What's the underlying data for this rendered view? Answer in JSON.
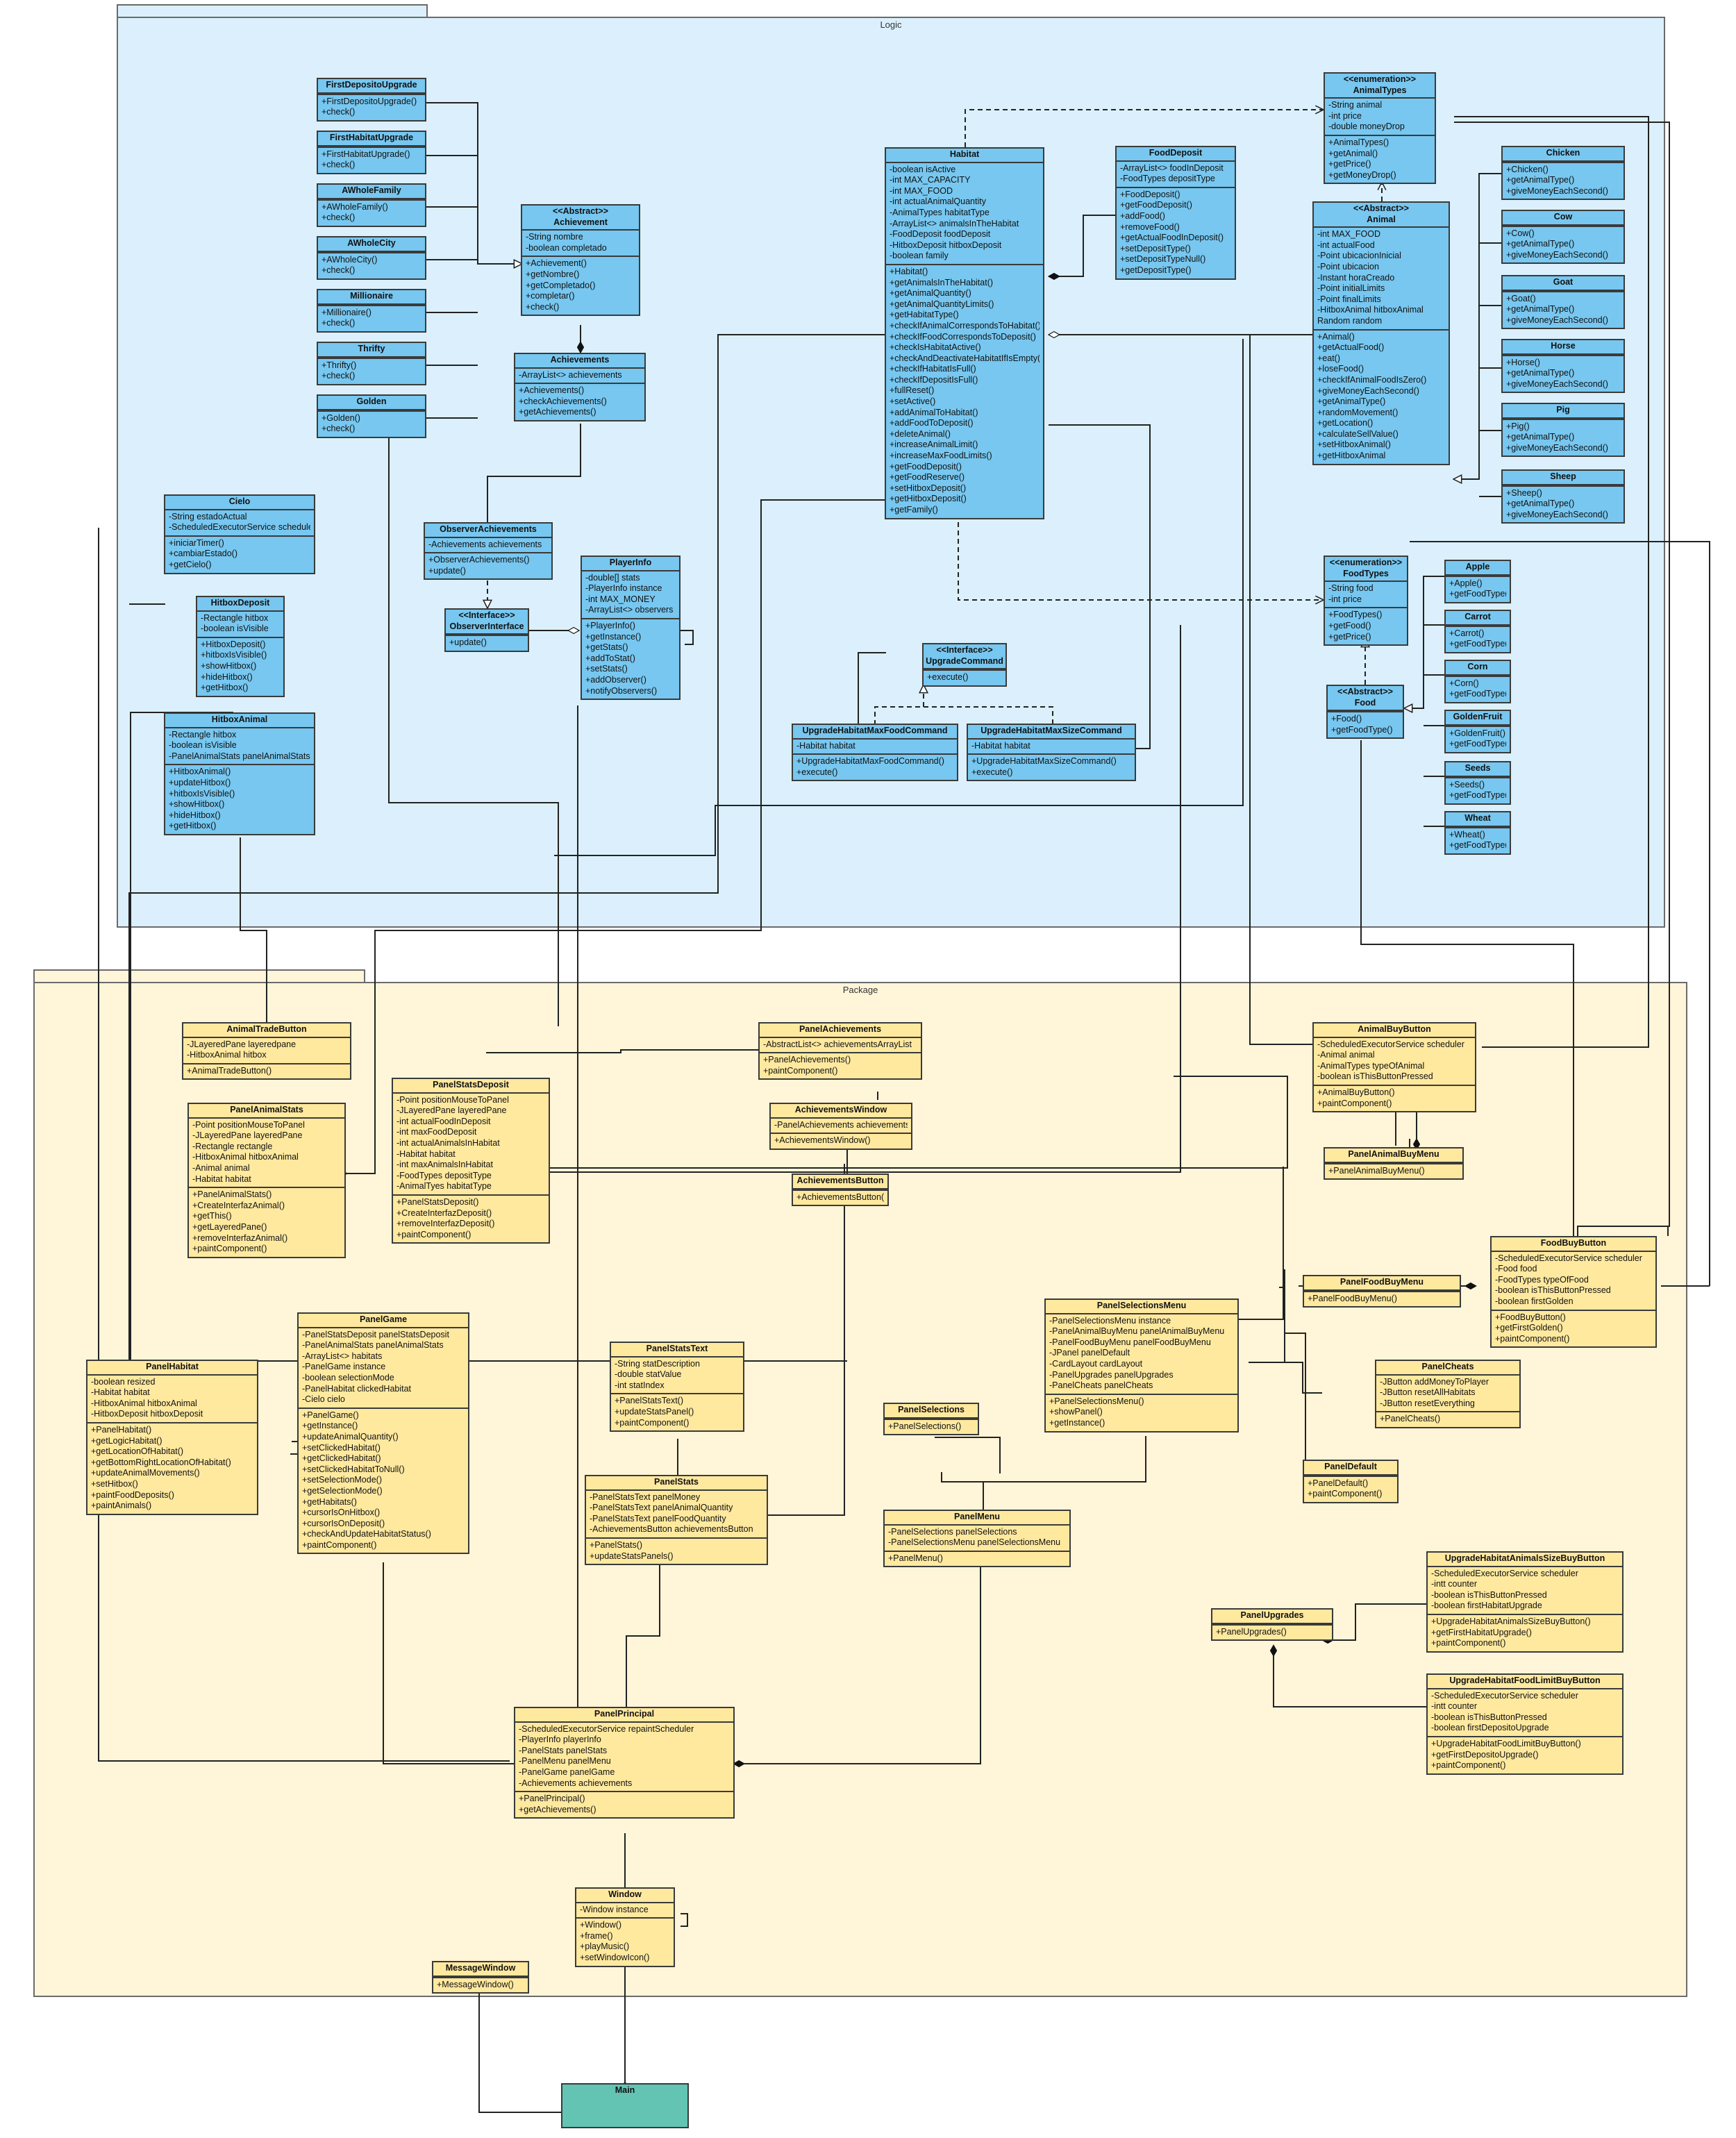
{
  "packages": {
    "logic": "Logic",
    "package": "Package"
  },
  "classes": [
    {
      "id": "first-deposito-upgrade",
      "name": [
        "FirstDepositoUpgrade"
      ],
      "attrs": [],
      "methods": [
        "+FirstDepositoUpgrade()",
        "+check()"
      ]
    },
    {
      "id": "first-habitat-upgrade",
      "name": [
        "FirstHabitatUpgrade"
      ],
      "attrs": [],
      "methods": [
        "+FirstHabitatUpgrade()",
        "+check()"
      ]
    },
    {
      "id": "a-whole-family",
      "name": [
        "AWholeFamily"
      ],
      "attrs": [],
      "methods": [
        "+AWholeFamily()",
        "+check()"
      ]
    },
    {
      "id": "a-whole-city",
      "name": [
        "AWholeCity"
      ],
      "attrs": [],
      "methods": [
        "+AWholeCity()",
        "+check()"
      ]
    },
    {
      "id": "millionaire",
      "name": [
        "Millionaire"
      ],
      "attrs": [],
      "methods": [
        "+Millionaire()",
        "+check()"
      ]
    },
    {
      "id": "thrifty",
      "name": [
        "Thrifty"
      ],
      "attrs": [],
      "methods": [
        "+Thrifty()",
        "+check()"
      ]
    },
    {
      "id": "golden",
      "name": [
        "Golden"
      ],
      "attrs": [],
      "methods": [
        "+Golden()",
        "+check()"
      ]
    },
    {
      "id": "achievement",
      "name": [
        "<<Abstract>>",
        "Achievement"
      ],
      "attrs": [
        "-String nombre",
        "-boolean completado"
      ],
      "methods": [
        "+Achievement()",
        "+getNombre()",
        "+getCompletado()",
        "+completar()",
        "+check()"
      ]
    },
    {
      "id": "achievements",
      "name": [
        "Achievements"
      ],
      "attrs": [
        "-ArrayList<> achievements"
      ],
      "methods": [
        "+Achievements()",
        "+checkAchievements()",
        "+getAchievements()"
      ]
    },
    {
      "id": "cielo",
      "name": [
        "Cielo"
      ],
      "attrs": [
        "-String estadoActual",
        "-ScheduledExecutorService scheduler"
      ],
      "methods": [
        "+iniciarTimer()",
        "+cambiarEstado()",
        "+getCielo()"
      ]
    },
    {
      "id": "hitbox-deposit",
      "name": [
        "HitboxDeposit"
      ],
      "attrs": [
        "-Rectangle hitbox",
        "-boolean isVisible"
      ],
      "methods": [
        "+HitboxDeposit()",
        "+hitboxIsVisible()",
        "+showHitbox()",
        "+hideHitbox()",
        "+getHitbox()"
      ]
    },
    {
      "id": "hitbox-animal",
      "name": [
        "HitboxAnimal"
      ],
      "attrs": [
        "-Rectangle hitbox",
        "-boolean isVisible",
        "-PanelAnimalStats panelAnimalStats"
      ],
      "methods": [
        "+HitboxAnimal()",
        "+updateHitbox()",
        "+hitboxIsVisible()",
        "+showHitbox()",
        "+hideHitbox()",
        "+getHitbox()"
      ]
    },
    {
      "id": "observer-achievements",
      "name": [
        "ObserverAchievements"
      ],
      "attrs": [
        "-Achievements achievements"
      ],
      "methods": [
        "+ObserverAchievements()",
        "+update()"
      ]
    },
    {
      "id": "observer-interface",
      "name": [
        "<<Interface>>",
        "ObserverInterface"
      ],
      "attrs": [],
      "methods": [
        "+update()"
      ]
    },
    {
      "id": "player-info",
      "name": [
        "PlayerInfo"
      ],
      "attrs": [
        "-double[] stats",
        "-PlayerInfo instance",
        "-int MAX_MONEY",
        "-ArrayList<> observers"
      ],
      "methods": [
        "+PlayerInfo()",
        "+getInstance()",
        "+getStats()",
        "+addToStat()",
        "+setStats()",
        "+addObserver()",
        "+notifyObservers()"
      ]
    },
    {
      "id": "habitat",
      "name": [
        "Habitat"
      ],
      "attrs": [
        "-boolean isActive",
        "-int MAX_CAPACITY",
        "-int MAX_FOOD",
        "-int actualAnimalQuantity",
        "-AnimalTypes habitatType",
        "-ArrayList<> animalsInTheHabitat",
        "-FoodDeposit foodDeposit",
        "-HitboxDeposit hitboxDeposit",
        "-boolean family"
      ],
      "methods": [
        "+Habitat()",
        "+getAnimalsInTheHabitat()",
        "+getAnimalQuantity()",
        "+getAnimalQuantityLimits()",
        "+getHabitatType()",
        "+checkIfAnimalCorrespondsToHabitat()",
        "+checkIfFoodCorrespondsToDeposit()",
        "+checkIsHabitatActive()",
        "+checkAndDeactivateHabitatIfIsEmpty()",
        "+checkIfHabitatIsFull()",
        "+checkIfDepositIsFull()",
        "+fullReset()",
        "+setActive()",
        "+addAnimalToHabitat()",
        "+addFoodToDeposit()",
        "+deleteAnimal()",
        "+increaseAnimalLimit()",
        "+increaseMaxFoodLimits()",
        "+getFoodDeposit()",
        "+getFoodReserve()",
        "+setHitboxDeposit()",
        "+getHitboxDeposit()",
        "+getFamily()"
      ]
    },
    {
      "id": "food-deposit",
      "name": [
        "FoodDeposit"
      ],
      "attrs": [
        "-ArrayList<> foodInDeposit",
        "-FoodTypes depositType"
      ],
      "methods": [
        "+FoodDeposit()",
        "+getFoodDeposit()",
        "+addFood()",
        "+removeFood()",
        "+getActualFoodInDeposit()",
        "+setDepositType()",
        "+setDepositTypeNull()",
        "+getDepositType()"
      ]
    },
    {
      "id": "animal-types",
      "name": [
        "<<enumeration>>",
        "AnimalTypes"
      ],
      "attrs": [
        "-String animal",
        "-int price",
        "-double moneyDrop"
      ],
      "methods": [
        "+AnimalTypes()",
        "+getAnimal()",
        "+getPrice()",
        "+getMoneyDrop()"
      ]
    },
    {
      "id": "animal",
      "name": [
        "<<Abstract>>",
        "Animal"
      ],
      "attrs": [
        "-int MAX_FOOD",
        "-int actualFood",
        "-Point ubicacionInicial",
        "-Point ubicacion",
        "-Instant horaCreado",
        "-Point initialLimits",
        "-Point finalLimits",
        "-HitboxAnimal hitboxAnimal",
        "Random random"
      ],
      "methods": [
        "+Animal()",
        "+getActualFood()",
        "+eat()",
        "+loseFood()",
        "+checkIfAnimalFoodIsZero()",
        "+giveMoneyEachSecond()",
        "+getAnimalType()",
        "+randomMovement()",
        "+getLocation()",
        "+calculateSellValue()",
        "+setHitboxAnimal()",
        "+getHitboxAnimal"
      ]
    },
    {
      "id": "chicken",
      "name": [
        "Chicken"
      ],
      "attrs": [],
      "methods": [
        "+Chicken()",
        "+getAnimalType()",
        "+giveMoneyEachSecond()"
      ]
    },
    {
      "id": "cow",
      "name": [
        "Cow"
      ],
      "attrs": [],
      "methods": [
        "+Cow()",
        "+getAnimalType()",
        "+giveMoneyEachSecond()"
      ]
    },
    {
      "id": "goat",
      "name": [
        "Goat"
      ],
      "attrs": [],
      "methods": [
        "+Goat()",
        "+getAnimalType()",
        "+giveMoneyEachSecond()"
      ]
    },
    {
      "id": "horse",
      "name": [
        "Horse"
      ],
      "attrs": [],
      "methods": [
        "+Horse()",
        "+getAnimalType()",
        "+giveMoneyEachSecond()"
      ]
    },
    {
      "id": "pig",
      "name": [
        "Pig"
      ],
      "attrs": [],
      "methods": [
        "+Pig()",
        "+getAnimalType()",
        "+giveMoneyEachSecond()"
      ]
    },
    {
      "id": "sheep",
      "name": [
        "Sheep"
      ],
      "attrs": [],
      "methods": [
        "+Sheep()",
        "+getAnimalType()",
        "+giveMoneyEachSecond()"
      ]
    },
    {
      "id": "food-types",
      "name": [
        "<<enumeration>>",
        "FoodTypes"
      ],
      "attrs": [
        "-String food",
        "-int price"
      ],
      "methods": [
        "+FoodTypes()",
        "+getFood()",
        "+getPrice()"
      ]
    },
    {
      "id": "food",
      "name": [
        "<<Abstract>>",
        "Food"
      ],
      "attrs": [],
      "methods": [
        "+Food()",
        "+getFoodType()"
      ]
    },
    {
      "id": "apple",
      "name": [
        "Apple"
      ],
      "attrs": [],
      "methods": [
        "+Apple()",
        "+getFoodType()"
      ]
    },
    {
      "id": "carrot",
      "name": [
        "Carrot"
      ],
      "attrs": [],
      "methods": [
        "+Carrot()",
        "+getFoodType()"
      ]
    },
    {
      "id": "corn",
      "name": [
        "Corn"
      ],
      "attrs": [],
      "methods": [
        "+Corn()",
        "+getFoodType()"
      ]
    },
    {
      "id": "golden-fruit",
      "name": [
        "GoldenFruit"
      ],
      "attrs": [],
      "methods": [
        "+GoldenFruit()",
        "+getFoodType()"
      ]
    },
    {
      "id": "seeds",
      "name": [
        "Seeds"
      ],
      "attrs": [],
      "methods": [
        "+Seeds()",
        "+getFoodType()"
      ]
    },
    {
      "id": "wheat",
      "name": [
        "Wheat"
      ],
      "attrs": [],
      "methods": [
        "+Wheat()",
        "+getFoodType()"
      ]
    },
    {
      "id": "upgrade-command",
      "name": [
        "<<Interface>>",
        "UpgradeCommand"
      ],
      "attrs": [],
      "methods": [
        "+execute()"
      ]
    },
    {
      "id": "upgrade-max-food-command",
      "name": [
        "UpgradeHabitatMaxFoodCommand"
      ],
      "attrs": [
        "-Habitat habitat"
      ],
      "methods": [
        "+UpgradeHabitatMaxFoodCommand()",
        "+execute()"
      ]
    },
    {
      "id": "upgrade-max-size-command",
      "name": [
        "UpgradeHabitatMaxSizeCommand"
      ],
      "attrs": [
        "-Habitat habitat"
      ],
      "methods": [
        "+UpgradeHabitatMaxSizeCommand()",
        "+execute()"
      ]
    },
    {
      "id": "animal-trade-button",
      "name": [
        "AnimalTradeButton"
      ],
      "attrs": [
        "-JLayeredPane layeredpane",
        "-HitboxAnimal hitbox"
      ],
      "methods": [
        "+AnimalTradeButton()"
      ]
    },
    {
      "id": "panel-animal-stats",
      "name": [
        "PanelAnimalStats"
      ],
      "attrs": [
        "-Point positionMouseToPanel",
        "-JLayeredPane layeredPane",
        "-Rectangle rectangle",
        "-HitboxAnimal hitboxAnimal",
        "-Animal animal",
        "-Habitat habitat"
      ],
      "methods": [
        "+PanelAnimalStats()",
        "+CreateInterfazAnimal()",
        "+getThis()",
        "+getLayeredPane()",
        "+removeInterfazAnimal()",
        "+paintComponent()"
      ]
    },
    {
      "id": "panel-stats-deposit",
      "name": [
        "PanelStatsDeposit"
      ],
      "attrs": [
        "-Point positionMouseToPanel",
        "-JLayeredPane layeredPane",
        "-int actualFoodInDeposit",
        "-int maxFoodDeposit",
        "-int actualAnimalsInHabitat",
        "-Habitat habitat",
        "-int maxAnimalsInHabitat",
        "-FoodTypes depositType",
        "-AnimalTyes habitatType"
      ],
      "methods": [
        "+PanelStatsDeposit()",
        "+CreateInterfazDeposit()",
        "+removeInterfazDeposit()",
        "+paintComponent()"
      ]
    },
    {
      "id": "panel-achievements",
      "name": [
        "PanelAchievements"
      ],
      "attrs": [
        "-AbstractList<> achievementsArrayList"
      ],
      "methods": [
        "+PanelAchievements()",
        "+paintComponent()"
      ]
    },
    {
      "id": "achievements-window",
      "name": [
        "AchievementsWindow"
      ],
      "attrs": [
        "-PanelAchievements achievements"
      ],
      "methods": [
        "+AchievementsWindow()"
      ]
    },
    {
      "id": "achievements-button",
      "name": [
        "AchievementsButton"
      ],
      "attrs": [],
      "methods": [
        "+AchievementsButton()"
      ]
    },
    {
      "id": "animal-buy-button",
      "name": [
        "AnimalBuyButton"
      ],
      "attrs": [
        "-ScheduledExecutorService scheduler",
        "-Animal animal",
        "-AnimalTypes typeOfAnimal",
        "-boolean isThisButtonPressed"
      ],
      "methods": [
        "+AnimalBuyButton()",
        "+paintComponent()"
      ]
    },
    {
      "id": "panel-animal-buy-menu",
      "name": [
        "PanelAnimalBuyMenu"
      ],
      "attrs": [],
      "methods": [
        "+PanelAnimalBuyMenu()"
      ]
    },
    {
      "id": "food-buy-button",
      "name": [
        "FoodBuyButton"
      ],
      "attrs": [
        "-ScheduledExecutorService scheduler",
        "-Food food",
        "-FoodTypes typeOfFood",
        "-boolean isThisButtonPressed",
        "-boolean firstGolden"
      ],
      "methods": [
        "+FoodBuyButton()",
        "+getFirstGolden()",
        "+paintComponent()"
      ]
    },
    {
      "id": "panel-food-buy-menu",
      "name": [
        "PanelFoodBuyMenu"
      ],
      "attrs": [],
      "methods": [
        "+PanelFoodBuyMenu()"
      ]
    },
    {
      "id": "panel-game",
      "name": [
        "PanelGame"
      ],
      "attrs": [
        "-PanelStatsDeposit panelStatsDeposit",
        "-PanelAnimalStats panelAnimalStats",
        "-ArrayList<> habitats",
        "-PanelGame instance",
        "-boolean selectionMode",
        "-PanelHabitat clickedHabitat",
        "-Cielo cielo"
      ],
      "methods": [
        "+PanelGame()",
        "+getInstance()",
        "+updateAnimalQuantity()",
        "+setClickedHabitat()",
        "+getClickedHabitat()",
        "+setClickedHabitatToNull()",
        "+setSelectionMode()",
        "+getSelectionMode()",
        "+getHabitats()",
        "+cursorIsOnHitbox()",
        "+cursorIsOnDeposit()",
        "+checkAndUpdateHabitatStatus()",
        "+paintComponent()"
      ]
    },
    {
      "id": "panel-habitat",
      "name": [
        "PanelHabitat"
      ],
      "attrs": [
        "-boolean resized",
        "-Habitat habitat",
        "-HitboxAnimal hitboxAnimal",
        "-HitboxDeposit hitboxDeposit"
      ],
      "methods": [
        "+PanelHabitat()",
        "+getLogicHabitat()",
        "+getLocationOfHabitat()",
        "+getBottomRightLocationOfHabitat()",
        "+updateAnimalMovements()",
        "+setHitbox()",
        "+paintFoodDeposits()",
        "+paintAnimals()"
      ]
    },
    {
      "id": "panel-stats-text",
      "name": [
        "PanelStatsText"
      ],
      "attrs": [
        "-String statDescription",
        "-double statValue",
        "-int statIndex"
      ],
      "methods": [
        "+PanelStatsText()",
        "+updateStatsPanel()",
        "+paintComponent()"
      ]
    },
    {
      "id": "panel-stats",
      "name": [
        "PanelStats"
      ],
      "attrs": [
        "-PanelStatsText panelMoney",
        "-PanelStatsText panelAnimalQuantity",
        "-PanelStatsText panelFoodQuantity",
        "-AchievementsButton achievementsButton"
      ],
      "methods": [
        "+PanelStats()",
        "+updateStatsPanels()"
      ]
    },
    {
      "id": "panel-selections",
      "name": [
        "PanelSelections"
      ],
      "attrs": [],
      "methods": [
        "+PanelSelections()"
      ]
    },
    {
      "id": "panel-menu",
      "name": [
        "PanelMenu"
      ],
      "attrs": [
        "-PanelSelections panelSelections",
        "-PanelSelectionsMenu panelSelectionsMenu"
      ],
      "methods": [
        "+PanelMenu()"
      ]
    },
    {
      "id": "panel-selections-menu",
      "name": [
        "PanelSelectionsMenu"
      ],
      "attrs": [
        "-PanelSelectionsMenu instance",
        "-PanelAnimalBuyMenu panelAnimalBuyMenu",
        "-PanelFoodBuyMenu panelFoodBuyMenu",
        "-JPanel panelDefault",
        "-CardLayout cardLayout",
        "-PanelUpgrades panelUpgrades",
        "-PanelCheats panelCheats"
      ],
      "methods": [
        "+PanelSelectionsMenu()",
        "+showPanel()",
        "+getInstance()"
      ]
    },
    {
      "id": "panel-cheats",
      "name": [
        "PanelCheats"
      ],
      "attrs": [
        "-JButton addMoneyToPlayer",
        "-JButton resetAllHabitats",
        "-JButton resetEverything"
      ],
      "methods": [
        "+PanelCheats()"
      ]
    },
    {
      "id": "panel-default",
      "name": [
        "PanelDefault"
      ],
      "attrs": [],
      "methods": [
        "+PanelDefault()",
        "+paintComponent()"
      ]
    },
    {
      "id": "panel-upgrades",
      "name": [
        "PanelUpgrades"
      ],
      "attrs": [],
      "methods": [
        "+PanelUpgrades()"
      ]
    },
    {
      "id": "upgrade-animals-size-buy-button",
      "name": [
        "UpgradeHabitatAnimalsSizeBuyButton"
      ],
      "attrs": [
        "-ScheduledExecutorService scheduler",
        "-intt counter",
        "-boolean isThisButtonPressed",
        "-boolean firstHabitatUpgrade"
      ],
      "methods": [
        "+UpgradeHabitatAnimalsSizeBuyButton()",
        "+getFirstHabitatUpgrade()",
        "+paintComponent()"
      ]
    },
    {
      "id": "upgrade-food-limit-buy-button",
      "name": [
        "UpgradeHabitatFoodLimitBuyButton"
      ],
      "attrs": [
        "-ScheduledExecutorService scheduler",
        "-intt counter",
        "-boolean isThisButtonPressed",
        "-boolean firstDepositoUpgrade"
      ],
      "methods": [
        "+UpgradeHabitatFoodLimitBuyButton()",
        "+getFirstDepositoUpgrade()",
        "+paintComponent()"
      ]
    },
    {
      "id": "panel-principal",
      "name": [
        "PanelPrincipal"
      ],
      "attrs": [
        "-ScheduledExecutorService repaintScheduler",
        "-PlayerInfo playerInfo",
        "-PanelStats panelStats",
        "-PanelMenu panelMenu",
        "-PanelGame panelGame",
        "-Achievements achievements"
      ],
      "methods": [
        "+PanelPrincipal()",
        "+getAchievements()"
      ]
    },
    {
      "id": "window",
      "name": [
        "Window"
      ],
      "attrs": [
        "-Window instance"
      ],
      "methods": [
        "+Window()",
        "+frame()",
        "+playMusic()",
        "+setWindowIcon()"
      ]
    },
    {
      "id": "message-window",
      "name": [
        "MessageWindow"
      ],
      "attrs": [],
      "methods": [
        "+MessageWindow()"
      ]
    },
    {
      "id": "main",
      "name": [
        "Main"
      ],
      "attrs": [],
      "methods": []
    }
  ]
}
